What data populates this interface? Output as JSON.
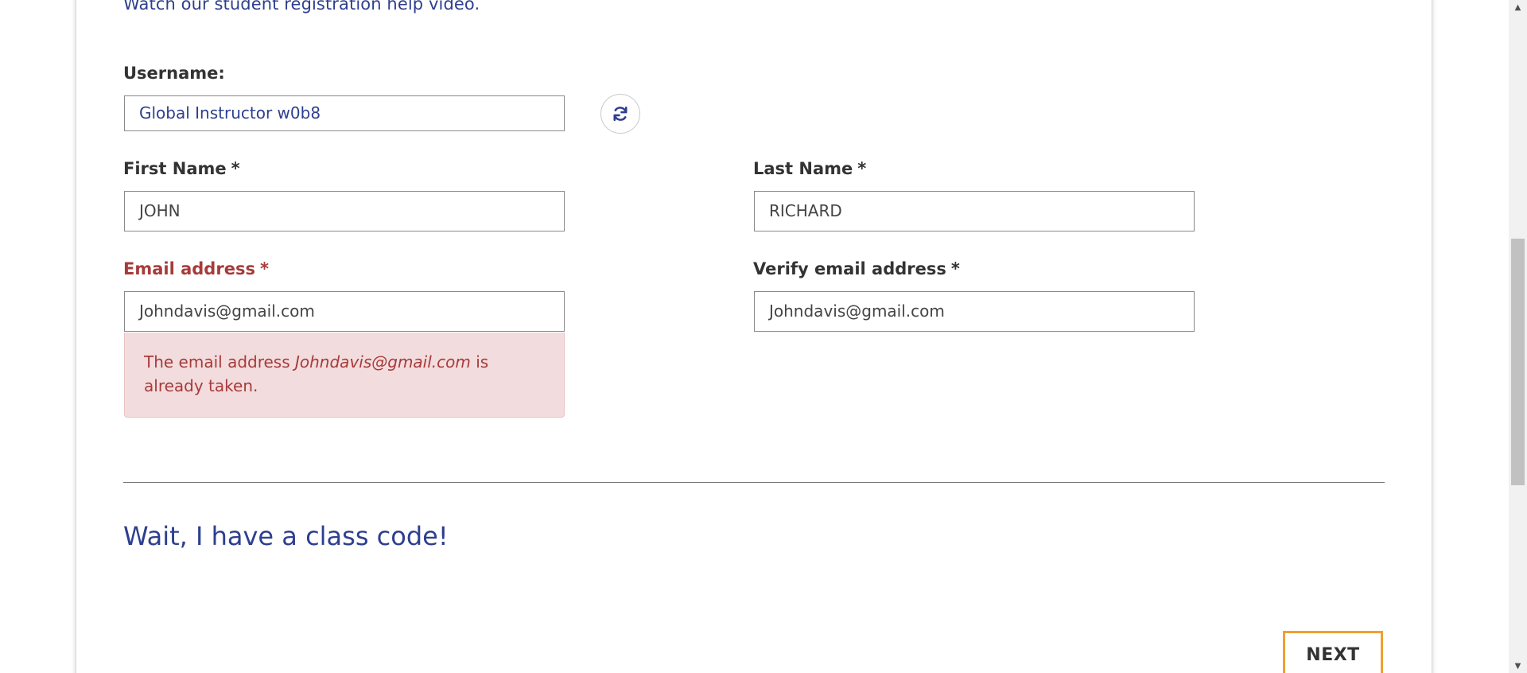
{
  "help_link": "Watch our student registration help video.",
  "username": {
    "label": "Username:",
    "value": "Global Instructor w0b8"
  },
  "refresh_icon": "refresh-icon",
  "first_name": {
    "label": "First Name",
    "required_mark": "*",
    "value": "JOHN"
  },
  "last_name": {
    "label": "Last Name",
    "required_mark": "*",
    "value": "RICHARD"
  },
  "email": {
    "label": "Email address",
    "required_mark": "*",
    "value": "Johndavis@gmail.com",
    "error_prefix": "The email address ",
    "error_email": "Johndavis@gmail.com",
    "error_suffix": " is already taken."
  },
  "verify_email": {
    "label": "Verify email address",
    "required_mark": "*",
    "value": "Johndavis@gmail.com"
  },
  "class_code_link": "Wait, I have a class code!",
  "next_button": "NEXT",
  "colors": {
    "link_blue": "#2e3f8f",
    "error_red": "#a63b3b",
    "error_bg": "#f3dcdd",
    "next_border": "#f0a030"
  }
}
